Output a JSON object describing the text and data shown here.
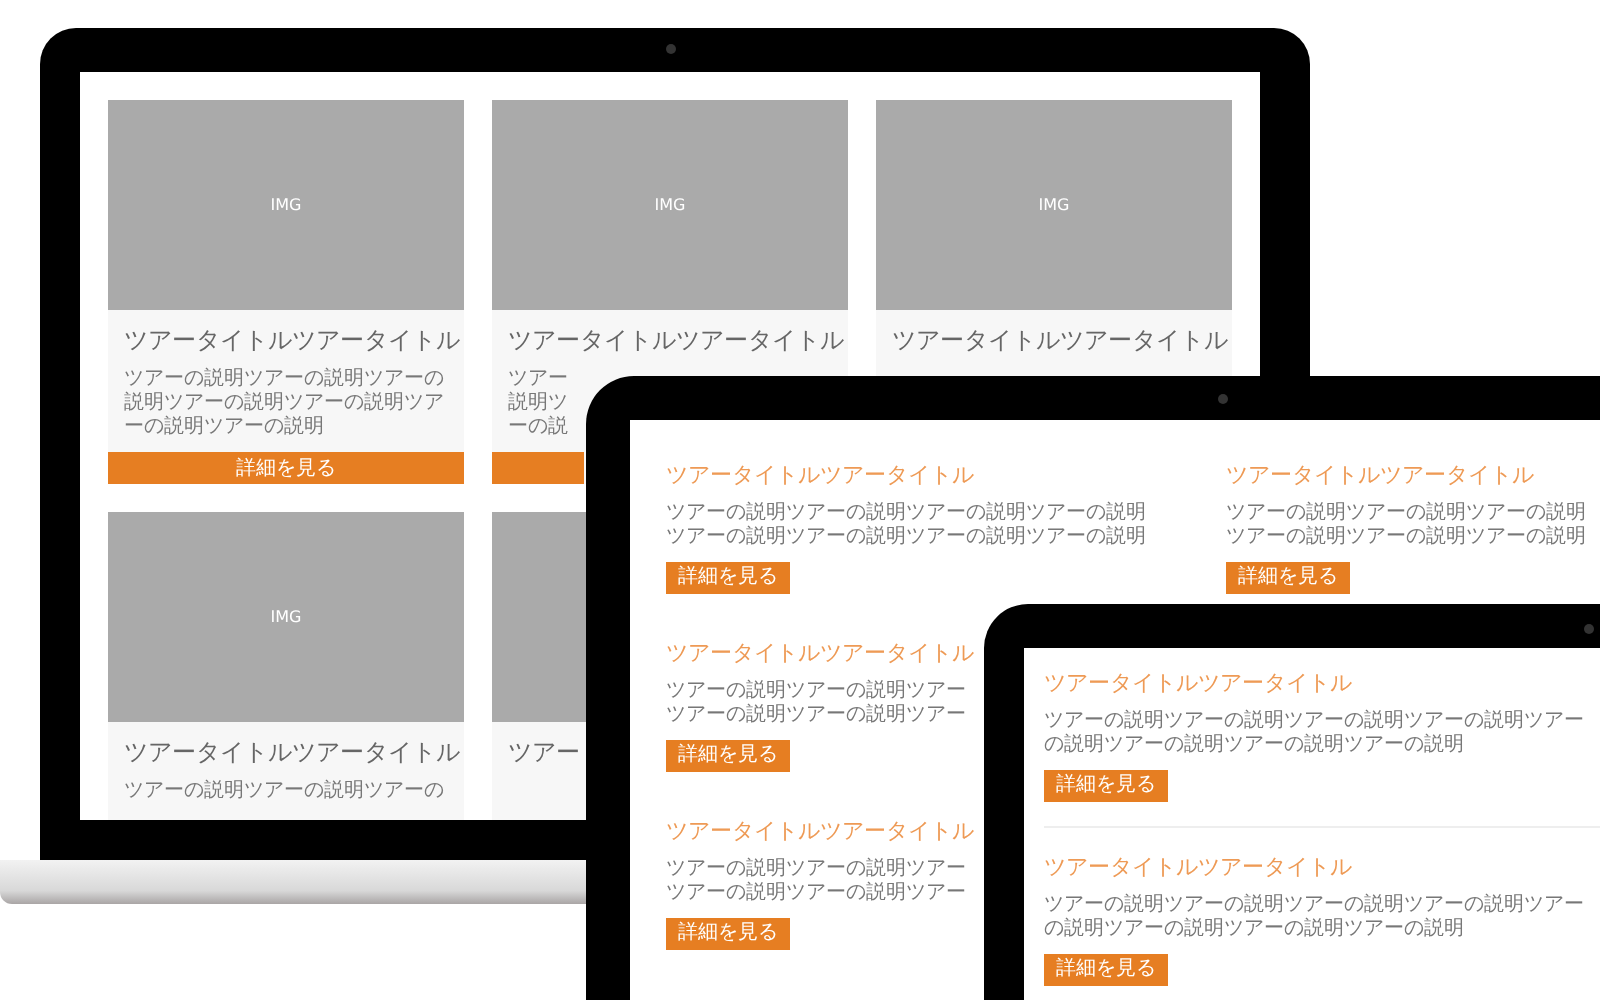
{
  "laptop": {
    "cards": [
      {
        "image_label": "IMG",
        "title": "ツアータイトルツアータイトル",
        "description_lines": [
          "ツアーの説明ツアーの説明ツアーの",
          "説明ツアーの説明ツアーの説明ツア",
          "ーの説明ツアーの説明"
        ],
        "button": {
          "kind": "bar",
          "label": "詳細を見る"
        }
      },
      {
        "image_label": "IMG",
        "title": "ツアータイトルツアータイトル",
        "description_lines": [
          "ツアー",
          "説明ツ",
          "ーの説"
        ],
        "button": {
          "kind": "bar"
        }
      },
      {
        "image_label": "IMG",
        "title": "ツアータイトルツアータイトル"
      },
      {
        "image_label": "IMG",
        "title": "ツアータイトルツアータイトル",
        "description_lines": [
          "ツアーの説明ツアーの説明ツアーの"
        ]
      },
      {
        "title": "ツアー"
      }
    ]
  },
  "tablet": {
    "columns": [
      {
        "items": [
          {
            "title": "ツアータイトルツアータイトル",
            "description_lines": [
              "ツアーの説明ツアーの説明ツアーの説明ツアーの説明",
              "ツアーの説明ツアーの説明ツアーの説明ツアーの説明"
            ],
            "button": "詳細を見る"
          },
          {
            "title": "ツアータイトルツアータイトル",
            "description_lines": [
              "ツアーの説明ツアーの説明ツアー",
              "ツアーの説明ツアーの説明ツアー"
            ],
            "button": "詳細を見る"
          },
          {
            "title": "ツアータイトルツアータイトル",
            "description_lines": [
              "ツアーの説明ツアーの説明ツアー",
              "ツアーの説明ツアーの説明ツアー"
            ],
            "button": "詳細を見る"
          }
        ]
      },
      {
        "items": [
          {
            "title": "ツアータイトルツアータイトル",
            "description_lines": [
              "ツアーの説明ツアーの説明ツアーの説明",
              "ツアーの説明ツアーの説明ツアーの説明"
            ],
            "button": "詳細を見る"
          }
        ]
      }
    ]
  },
  "phone": {
    "items": [
      {
        "title": "ツアータイトルツアータイトル",
        "description_lines": [
          "ツアーの説明ツアーの説明ツアーの説明ツアーの説明ツアー",
          "の説明ツアーの説明ツアーの説明ツアーの説明"
        ],
        "button": "詳細を見る"
      },
      {
        "title": "ツアータイトルツアータイトル",
        "description_lines": [
          "ツアーの説明ツアーの説明ツアーの説明ツアーの説明ツアー",
          "の説明ツアーの説明ツアーの説明ツアーの説明"
        ],
        "button": "詳細を見る"
      }
    ]
  }
}
